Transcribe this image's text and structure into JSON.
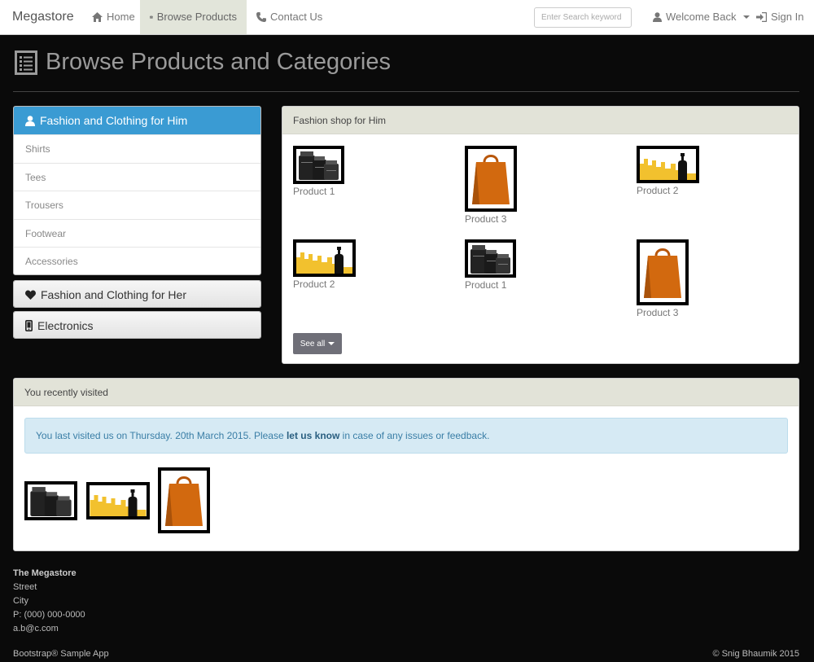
{
  "navbar": {
    "brand": "Megastore",
    "home": "Home",
    "browse": "Browse Products",
    "contact": "Contact Us",
    "search_placeholder": "Enter Search keyword",
    "welcome": "Welcome Back",
    "signin": "Sign In"
  },
  "page": {
    "title": "Browse Products and Categories"
  },
  "sidebar": {
    "active_category": "Fashion and Clothing for Him",
    "items": [
      "Shirts",
      "Tees",
      "Trousers",
      "Footwear",
      "Accessories"
    ],
    "category_her": "Fashion and Clothing for Her",
    "category_electronics": "Electronics"
  },
  "products_panel": {
    "heading": "Fashion shop for Him",
    "products": [
      {
        "name": "Product 1",
        "image": "jars-icon"
      },
      {
        "name": "Product 3",
        "image": "shopping-bag-icon"
      },
      {
        "name": "Product 2",
        "image": "skyline-bottle-icon"
      },
      {
        "name": "Product 2",
        "image": "skyline-bottle-icon"
      },
      {
        "name": "Product 1",
        "image": "jars-icon"
      },
      {
        "name": "Product 3",
        "image": "shopping-bag-icon"
      }
    ],
    "see_all": "See all"
  },
  "recent": {
    "heading": "You recently visited",
    "alert_prefix": "You last visited us on Thursday. 20th March 2015. Please ",
    "alert_link": "let us know",
    "alert_suffix": " in case of any issues or feedback.",
    "thumbs": [
      "jars-icon",
      "skyline-bottle-icon",
      "shopping-bag-icon"
    ]
  },
  "footer": {
    "name": "The Megastore",
    "street": "Street",
    "city": "City",
    "phone": "P: (000) 000-0000",
    "email": "a.b@c.com",
    "left": "Bootstrap® Sample App",
    "right": "© Snig Bhaumik 2015"
  },
  "colors": {
    "accent": "#3a9bd3",
    "panel_head": "#e2e3d8",
    "bag_orange": "#d2690f",
    "skyline_yellow": "#f2c12e"
  }
}
